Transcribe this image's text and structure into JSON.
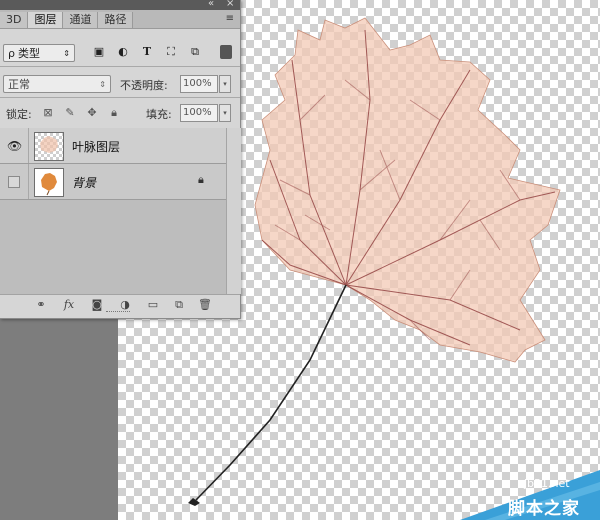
{
  "panel": {
    "tabs": [
      {
        "label": "3D"
      },
      {
        "label": "图层"
      },
      {
        "label": "通道"
      },
      {
        "label": "路径"
      }
    ],
    "filter": {
      "glyph": "ρ",
      "label": "类型",
      "icons": [
        "image-filter-icon",
        "adjustment-filter-icon",
        "type-filter-icon",
        "shape-filter-icon",
        "smart-object-filter-icon"
      ]
    },
    "blend_mode": "正常",
    "opacity_label": "不透明度:",
    "opacity_value": "100%",
    "lock_label": "锁定:",
    "fill_label": "填充:",
    "fill_value": "100%",
    "layers": [
      {
        "name": "叶脉图层",
        "visible": true,
        "selected": true
      },
      {
        "name": "背景",
        "visible": false,
        "locked": true
      }
    ],
    "bottom_icons": [
      "link-layers-icon",
      "fx-icon",
      "add-mask-icon",
      "adjustment-layer-icon",
      "new-group-icon",
      "new-layer-icon",
      "delete-layer-icon"
    ],
    "fx_label": "fx"
  },
  "watermark": {
    "site": "jb51.net",
    "name": "脚本之家"
  },
  "colors": {
    "leaf_fill": "#f3c7b3",
    "leaf_vein": "#8a3535",
    "stem": "#222222",
    "watermark_blue": "#3aa0d8"
  }
}
